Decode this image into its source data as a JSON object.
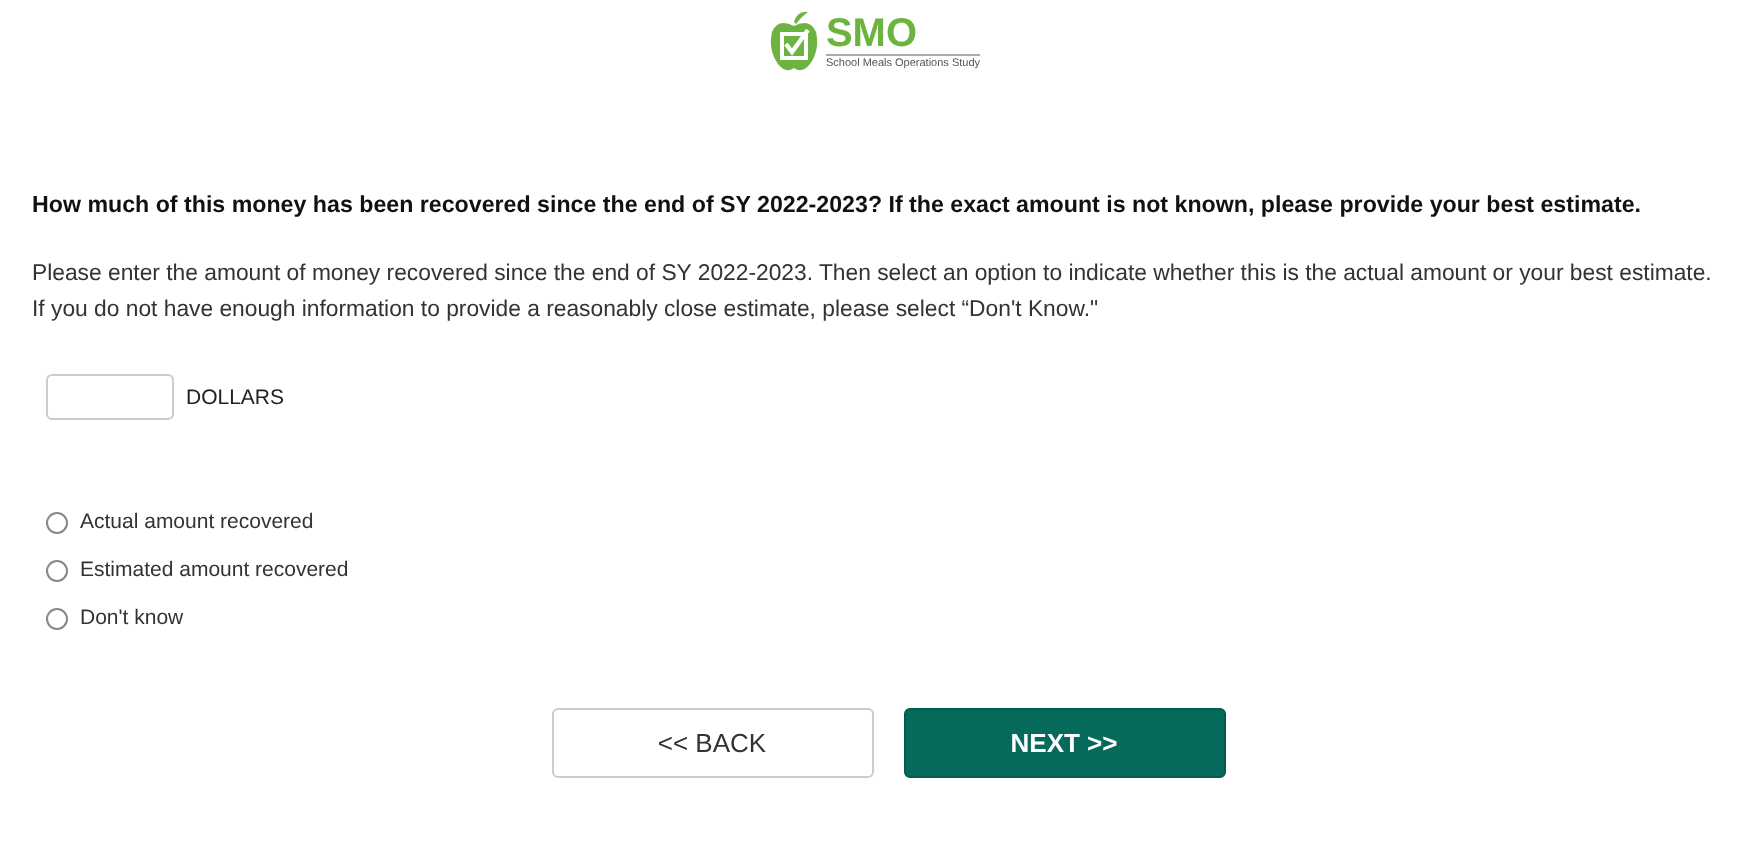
{
  "logo": {
    "title": "SMO",
    "subtitle": "School Meals Operations Study"
  },
  "question": "How much of this money has been recovered since the end of SY 2022-2023? If the exact amount is not known, please provide your best estimate.",
  "instructions": "Please enter the amount of money recovered since the end of SY 2022-2023. Then select an option to indicate whether this is the actual amount or your best estimate. If you do not have enough information to provide a reasonably close estimate, please select “Don't Know.\"",
  "amount_field": {
    "unit": "DOLLARS"
  },
  "options": [
    {
      "label": "Actual amount recovered",
      "selected": false
    },
    {
      "label": "Estimated amount recovered",
      "selected": false
    },
    {
      "label": "Don't know",
      "selected": false
    }
  ],
  "buttons": [
    {
      "label": "<< BACK",
      "kind": "secondary"
    },
    {
      "label": "NEXT >>",
      "kind": "primary"
    }
  ]
}
